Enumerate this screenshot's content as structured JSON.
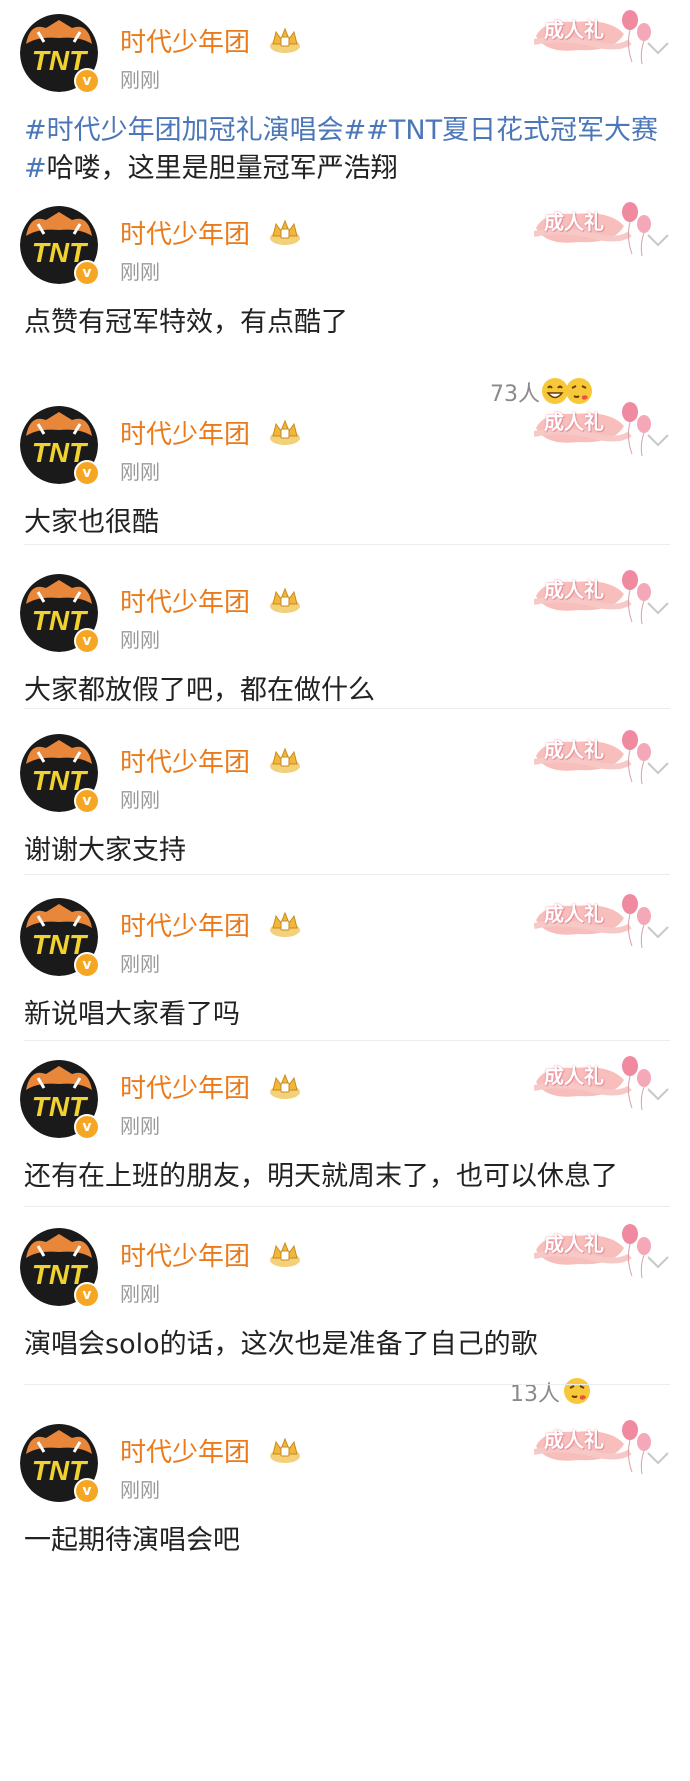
{
  "author": {
    "name": "时代少年团",
    "time": "刚刚",
    "avatar_text": "TNT",
    "verified_label": "v"
  },
  "decoration_label": "成人礼",
  "colors": {
    "name": "#ea7a1a",
    "hashtag": "#4b77b8",
    "avatar_bg": "#1a1a1a",
    "avatar_accent": "#f2d230",
    "badge": "#f5a623"
  },
  "posts": [
    {
      "segments": [
        {
          "text": "#时代少年团加冠礼演唱会#",
          "hashtag": true
        },
        {
          "text": "#TNT夏日花式冠军大赛#",
          "hashtag": true
        },
        {
          "text": "哈喽，这里是胆量冠军严浩翔",
          "hashtag": false
        }
      ]
    },
    {
      "text": "点赞有冠军特效，有点酷了",
      "reaction_count": "73人",
      "reaction_icons": [
        "grin-emoji-icon",
        "kiss-emoji-icon"
      ]
    },
    {
      "text": "大家也很酷"
    },
    {
      "text": "大家都放假了吧，都在做什么"
    },
    {
      "text": "谢谢大家支持"
    },
    {
      "text": "新说唱大家看了吗"
    },
    {
      "text": "还有在上班的朋友，明天就周末了，也可以休息了"
    },
    {
      "text": "演唱会solo的话，这次也是准备了自己的歌",
      "reaction_count": "13人",
      "reaction_icons": [
        "kiss-emoji-icon"
      ]
    },
    {
      "text": "一起期待演唱会吧"
    }
  ]
}
